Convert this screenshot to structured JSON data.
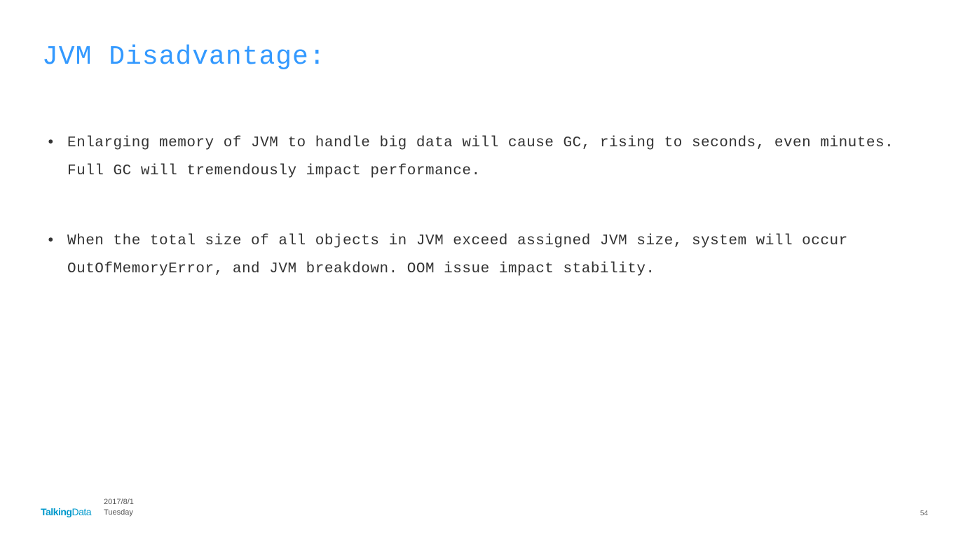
{
  "title": "JVM Disadvantage:",
  "bullets": [
    "Enlarging memory of JVM to handle big data will cause GC, rising to seconds, even minutes. Full GC will tremendously impact performance.",
    "When the total size of all objects in JVM exceed assigned JVM size, system will occur OutOfMemoryError, and JVM breakdown. OOM issue impact stability."
  ],
  "footer": {
    "brand_prefix": "Talking",
    "brand_suffix": "Data",
    "date": "2017/8/1",
    "day": "Tuesday",
    "page": "54"
  }
}
